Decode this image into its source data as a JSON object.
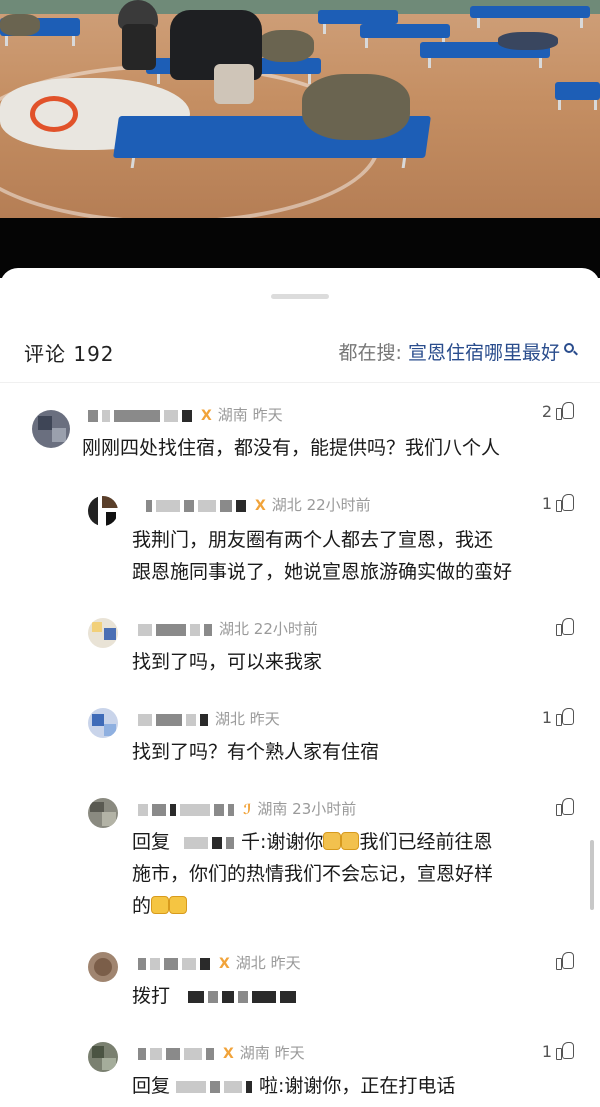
{
  "comments_header": {
    "count_label": "评论 192",
    "search_prefix": "都在搜:",
    "search_keyword": "宣恩住宿哪里最好"
  },
  "comments": [
    {
      "region": "湖南",
      "time": "昨天",
      "likes": "2",
      "text": "刚刚四处找住宿，都没有，能提供吗？我们八个人"
    },
    {
      "region": "湖北",
      "time": "22小时前",
      "likes": "1",
      "text_line1": "我荆门，朋友圈有两个人都去了宣恩，我还",
      "text_line2": "跟恩施同事说了，她说宣恩旅游确实做的蛮好"
    },
    {
      "region": "湖北",
      "time": "22小时前",
      "likes": "",
      "text": "找到了吗，可以来我家"
    },
    {
      "region": "湖北",
      "time": "昨天",
      "likes": "1",
      "text": "找到了吗？有个熟人家有住宿"
    },
    {
      "region": "湖南",
      "time": "23小时前",
      "likes": "",
      "reply_prefix": "回复",
      "reply_tail": "千",
      "text_a": ":谢谢你",
      "text_b": "我们已经前往恩",
      "text_line2": "施市，你们的热情我们不会忘记，宣恩好样",
      "text_line3": "的"
    },
    {
      "region": "湖北",
      "time": "昨天",
      "likes": "",
      "text": "拨打"
    },
    {
      "region": "湖南",
      "time": "昨天",
      "likes": "1",
      "reply_prefix": "回复",
      "reply_tail": "啦",
      "text": ":谢谢你，正在打电话"
    }
  ],
  "icons": {
    "like": "thumbs-up-outline-icon",
    "search": "search-icon",
    "verified": "verified-badge-icon"
  },
  "colors": {
    "accent_link": "#2a4d8d",
    "badge": "#f1a33a",
    "meta_text": "#9a9a9a"
  }
}
